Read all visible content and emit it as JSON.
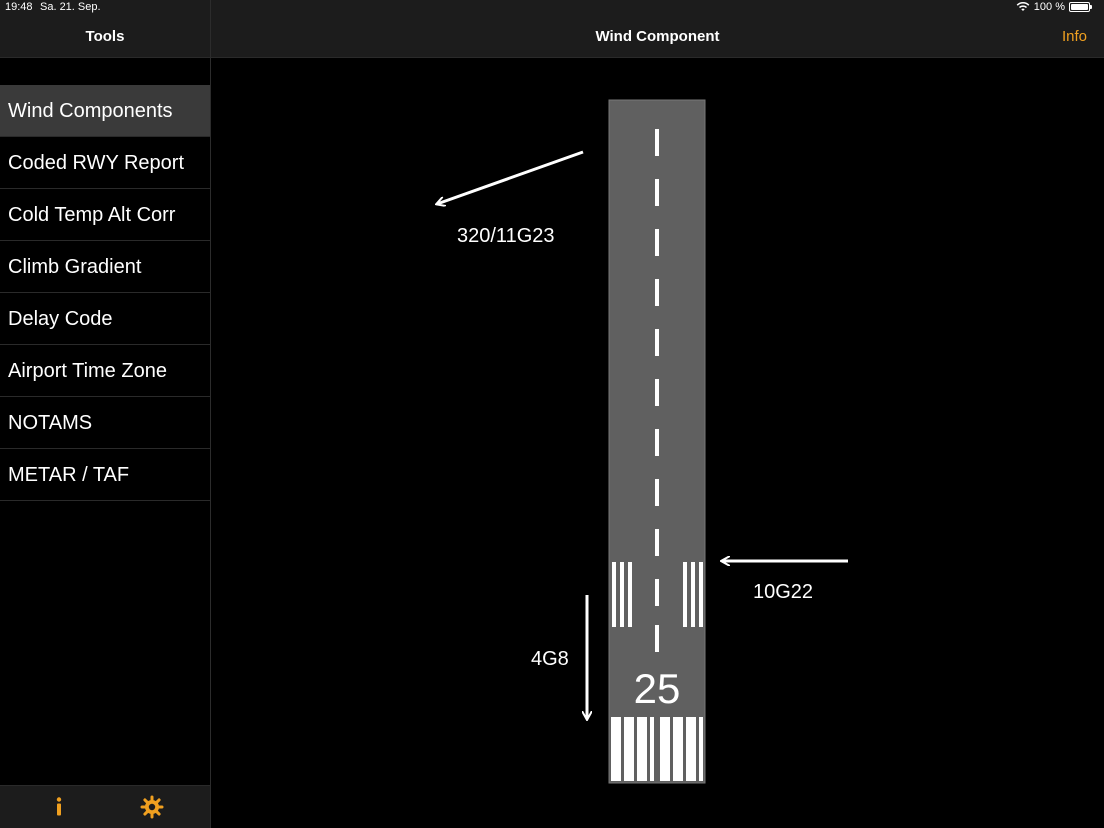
{
  "status": {
    "time": "19:48",
    "date": "Sa. 21. Sep.",
    "battery": "100 %"
  },
  "sidebar": {
    "title": "Tools",
    "items": [
      {
        "label": "Wind Components",
        "active": true
      },
      {
        "label": "Coded RWY Report"
      },
      {
        "label": "Cold Temp Alt Corr"
      },
      {
        "label": "Climb Gradient"
      },
      {
        "label": "Delay Code"
      },
      {
        "label": "Airport Time Zone"
      },
      {
        "label": "NOTAMS"
      },
      {
        "label": "METAR / TAF"
      }
    ],
    "footer_icons": [
      "info-icon",
      "gear-icon"
    ]
  },
  "main": {
    "title": "Wind Component",
    "info_label": "Info",
    "runway_number": "25",
    "wind_label": "320/11G23",
    "crosswind_label": "10G22",
    "headwind_label": "4G8"
  },
  "colors": {
    "accent": "#f0a020",
    "runway": "#606060",
    "header_bg": "#1c1c1c",
    "active_row": "#3a3a3a"
  }
}
